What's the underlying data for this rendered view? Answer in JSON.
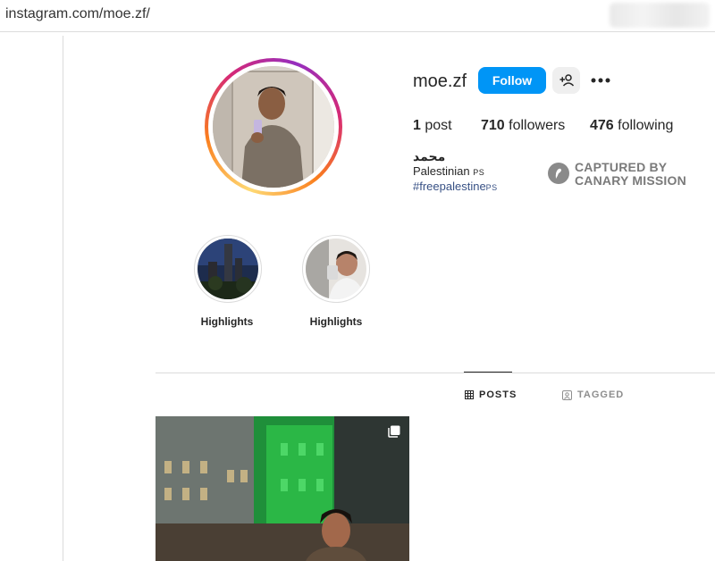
{
  "browser": {
    "url": "instagram.com/moe.zf/"
  },
  "profile": {
    "username": "moe.zf",
    "follow_label": "Follow",
    "stats": {
      "posts_count": "1",
      "posts_label": "post",
      "followers_count": "710",
      "followers_label": "followers",
      "following_count": "476",
      "following_label": "following"
    },
    "full_name": "محمد",
    "bio_text": "Palestinian ",
    "bio_flag": "PS",
    "hashtag": "#freepalestine",
    "hashtag_flag": "PS"
  },
  "watermark": {
    "line1": "CAPTURED BY",
    "line2": "CANARY MISSION"
  },
  "highlights": [
    {
      "label": "Highlights"
    },
    {
      "label": "Highlights"
    }
  ],
  "tabs": {
    "posts": "POSTS",
    "tagged": "TAGGED"
  },
  "colors": {
    "follow_blue": "#0095f6",
    "hashtag": "#385185",
    "watermark_gray": "#7a7a7a"
  }
}
